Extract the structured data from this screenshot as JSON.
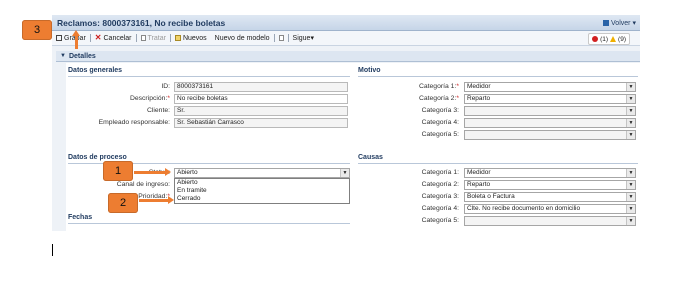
{
  "window": {
    "title": "Reclamos: 8000373161, No recibe boletas",
    "volver": "Volver"
  },
  "toolbar": {
    "grabar": "Grabar",
    "cancelar": "Cancelar",
    "tratar": "Tratar",
    "nuevos": "Nuevos",
    "nuevo_modelo": "Nuevo de modelo",
    "sigue": "Sigue▾",
    "messages": "(1)",
    "warnings": "(9)"
  },
  "detalles": {
    "label": "Detalles"
  },
  "datos_generales": {
    "title": "Datos generales",
    "id_label": "ID:",
    "id_value": "8000373161",
    "descripcion_label": "Descripción:",
    "descripcion_value": "No recibe boletas",
    "cliente_label": "Cliente:",
    "cliente_value": "Sr.",
    "empleado_label": "Empleado responsable:",
    "empleado_value": "Sr. Sebastián Carrasco"
  },
  "motivo": {
    "title": "Motivo",
    "items": [
      {
        "label": "Categoría 1:",
        "required": true,
        "value": "Medidor"
      },
      {
        "label": "Categoría 2:",
        "required": true,
        "value": "Reparto"
      },
      {
        "label": "Categoría 3:",
        "required": false,
        "value": ""
      },
      {
        "label": "Categoría 4:",
        "required": false,
        "value": ""
      },
      {
        "label": "Categoría 5:",
        "required": false,
        "value": ""
      }
    ]
  },
  "proceso": {
    "title": "Datos de proceso",
    "status_label": "Status:",
    "status_value": "Abierto",
    "canal_label": "Canal de ingreso:",
    "prioridad_label": "Prioridad:",
    "options": [
      "Abierto",
      "En tramite",
      "Cerrado"
    ]
  },
  "causas": {
    "title": "Causas",
    "items": [
      {
        "label": "Categoría 1:",
        "value": "Medidor"
      },
      {
        "label": "Categoría 2:",
        "value": "Reparto"
      },
      {
        "label": "Categoría 3:",
        "value": "Boleta o Factura"
      },
      {
        "label": "Categoría 4:",
        "value": "Clte. No recibe documento en domicilio"
      },
      {
        "label": "Categoría 5:",
        "value": ""
      }
    ]
  },
  "fechas": {
    "title": "Fechas"
  },
  "callouts": {
    "one": "1",
    "two": "2",
    "three": "3"
  },
  "colors": {
    "callout": "#ed7d31",
    "header": "#1f3a5f"
  }
}
